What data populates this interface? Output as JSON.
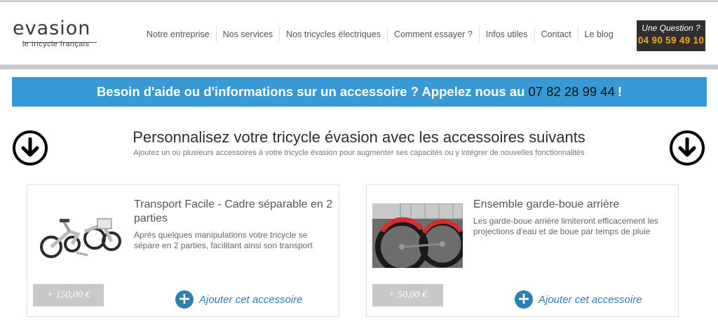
{
  "header": {
    "logo_word_left": "ev",
    "logo_word_mid": "a",
    "logo_word_right": "sion",
    "logo_tagline": "le tricycle français",
    "nav": [
      {
        "label": "Notre entreprise"
      },
      {
        "label": "Nos services"
      },
      {
        "label": "Nos tricycles électriques"
      },
      {
        "label": "Comment essayer ?"
      },
      {
        "label": "Infos utiles"
      },
      {
        "label": "Contact"
      },
      {
        "label": "Le blog"
      }
    ],
    "question_label": "Une Question ?",
    "question_phone": "04 90 59 49 10"
  },
  "banner": {
    "text": "Besoin d'aide ou d'informations sur un accessoire ? Appelez nous au",
    "phone": "07 82 28 99 44",
    "suffix": "!"
  },
  "section": {
    "title": "Personnalisez votre tricycle évasion avec les accessoires suivants",
    "subtitle": "Ajoutez un ou plusieurs accessoires à votre tricycle évasion pour augmenter ses capacités ou y intégrer de nouvelles fonctionnalités"
  },
  "accessories": [
    {
      "title": "Transport Facile - Cadre séparable en 2 parties",
      "description": "Après quelques manipulations votre tricycle se sépare en 2 parties, facilitant ainsi son transport",
      "price": "+ 150,00 €",
      "add_label": "Ajouter cet accessoire"
    },
    {
      "title": "Ensemble garde-boue arrière",
      "description": "Les garde-boue arrière limiteront efficacement les projections d'eau et de boue par temps de pluie",
      "price": "+ 50,00 €",
      "add_label": "Ajouter cet accessoire"
    }
  ],
  "colors": {
    "banner_bg": "#3799d5",
    "question_phone": "#f5a623",
    "add_link": "#2f7fb0",
    "price_bg": "#c8c8c8"
  }
}
